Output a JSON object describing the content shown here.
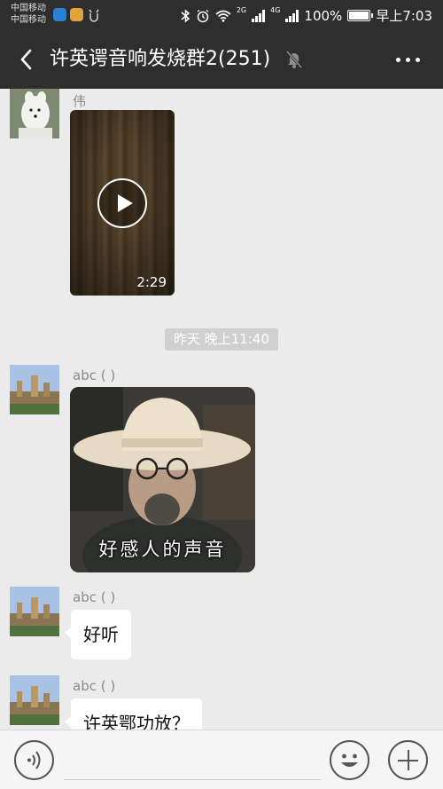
{
  "status_bar": {
    "carrier_1": "中国移动",
    "carrier_2": "中国移动",
    "network_1": "2G",
    "network_2": "4G",
    "battery": "100%",
    "time": "早上7:03"
  },
  "header": {
    "title": "许英谔音响发烧群2(251)",
    "muted": true
  },
  "messages": [
    {
      "sender": "伟",
      "type": "video",
      "duration": "2:29"
    },
    {
      "type": "timestamp",
      "text": "昨天 晚上11:40"
    },
    {
      "sender": "abc ( )",
      "type": "sticker",
      "caption": "好感人的声音"
    },
    {
      "sender": "abc ( )",
      "type": "text",
      "text": "好听"
    },
    {
      "sender": "abc ( )",
      "type": "text",
      "text": "许英鄂功放？"
    }
  ],
  "colors": {
    "header_bg": "#2e2e2e",
    "chat_bg": "#ebebeb",
    "timestamp_bg": "#d0d0d0",
    "bubble_bg": "#ffffff"
  }
}
